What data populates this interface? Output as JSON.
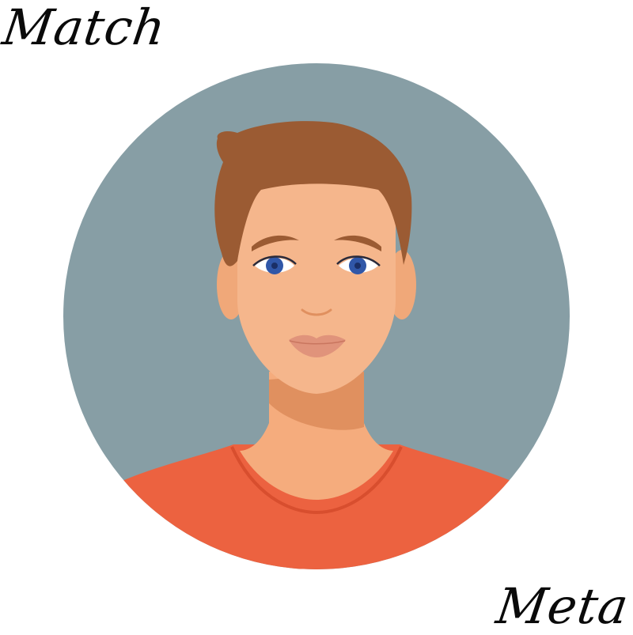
{
  "captions": {
    "top": "Match",
    "bottom": "Meta"
  },
  "avatar": {
    "icon": "man-avatar-icon",
    "colors": {
      "background_circle": "#879ea5",
      "hair": "#9b5b33",
      "skin": "#f5b68c",
      "skin_shadow": "#e0905f",
      "eyes": "#3057a8",
      "lips": "#e0937b",
      "shirt": "#ec6240",
      "collar": "#d84e2e"
    }
  }
}
